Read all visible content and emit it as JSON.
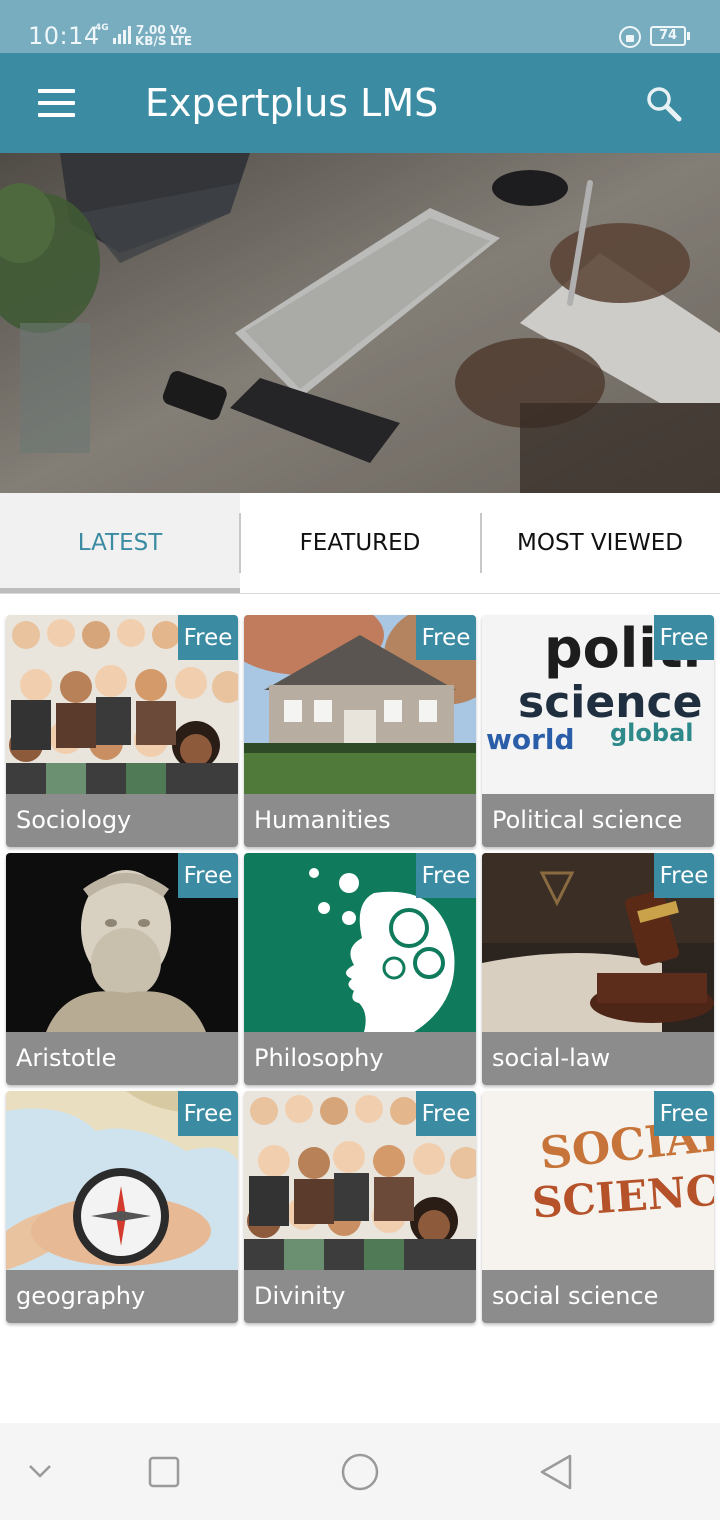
{
  "status_bar": {
    "time": "10:14",
    "network": "4G",
    "speed_value": "7.00",
    "speed_unit": "KB/S",
    "volte_top": "Vo",
    "volte_bottom": "LTE",
    "battery": "74"
  },
  "app_bar": {
    "title": "Expertplus LMS",
    "menu_icon": "hamburger-menu-icon",
    "search_icon": "search-icon"
  },
  "tabs": [
    {
      "label": "LATEST",
      "active": true
    },
    {
      "label": "FEATURED",
      "active": false
    },
    {
      "label": "MOST VIEWED",
      "active": false
    }
  ],
  "courses": [
    {
      "title": "Sociology",
      "badge": "Free"
    },
    {
      "title": "Humanities",
      "badge": "Free"
    },
    {
      "title": "Political science",
      "badge": "Free",
      "image_words": [
        "politi",
        "science",
        "world",
        "global"
      ]
    },
    {
      "title": "Aristotle",
      "badge": "Free"
    },
    {
      "title": "Philosophy",
      "badge": "Free"
    },
    {
      "title": "social-law",
      "badge": "Free"
    },
    {
      "title": "geography",
      "badge": "Free"
    },
    {
      "title": "Divinity",
      "badge": "Free"
    },
    {
      "title": "social science",
      "badge": "Free",
      "image_words": [
        "SOCIAL",
        "SCIENCE"
      ]
    }
  ],
  "colors": {
    "primary": "#3b8ba3",
    "status_bar": "#78acbf",
    "card_label": "#8c8c8c"
  }
}
